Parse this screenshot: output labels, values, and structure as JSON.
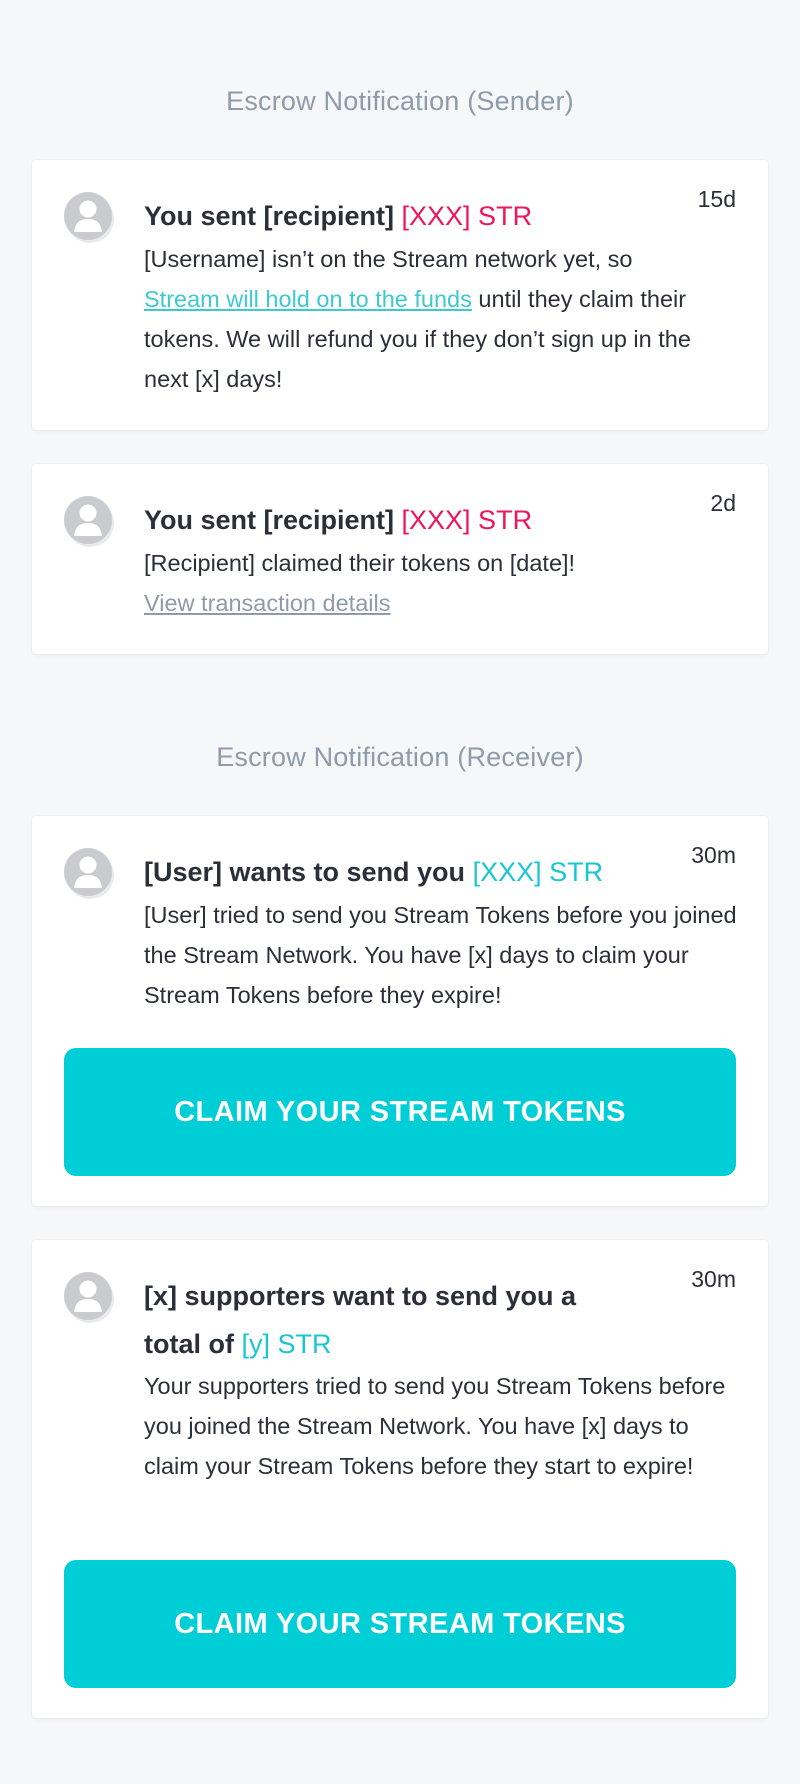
{
  "sender_section": {
    "title": "Escrow Notification (Sender)",
    "notifications": [
      {
        "time": "15d",
        "title_prefix": "You sent [recipient] ",
        "amount": "[XXX] STR",
        "body_before_link": "[Username] isn’t on the Stream network yet, so ",
        "link": "Stream will hold on to the funds",
        "body_after_link": " until they claim their tokens. We will refund you if they don’t sign up in the next [x] days!"
      },
      {
        "time": "2d",
        "title_prefix": "You sent [recipient] ",
        "amount": "[XXX] STR",
        "body": "[Recipient] claimed their tokens on [date]!",
        "link": "View transaction details"
      }
    ]
  },
  "receiver_section": {
    "title": "Escrow Notification (Receiver)",
    "notifications": [
      {
        "time": "30m",
        "title_prefix": "[User] wants to send you ",
        "amount": "[XXX] STR",
        "body": "[User] tried to send you Stream Tokens before you joined the Stream Network. You have [x] days to claim your Stream Tokens before they expire!",
        "button": "CLAIM YOUR STREAM TOKENS"
      },
      {
        "time": "30m",
        "title_prefix": "[x] supporters want to send you a total of ",
        "amount": "[y] STR",
        "body": "Your supporters tried to send you Stream Tokens before you joined the Stream Network. You have [x] days to claim your Stream Tokens before they start to expire!",
        "button": "CLAIM YOUR STREAM TOKENS"
      }
    ]
  },
  "icons": {
    "avatar": "user-avatar-icon"
  },
  "colors": {
    "background": "#f6f7f9",
    "card": "#ffffff",
    "section_title": "#8f9bab",
    "amount_sent": "#f0145a",
    "amount_received": "#19c6d3",
    "link": "#3cc9d2",
    "muted_link": "#8f9bab",
    "button": "#00ced6",
    "button_text": "#ffffff"
  }
}
